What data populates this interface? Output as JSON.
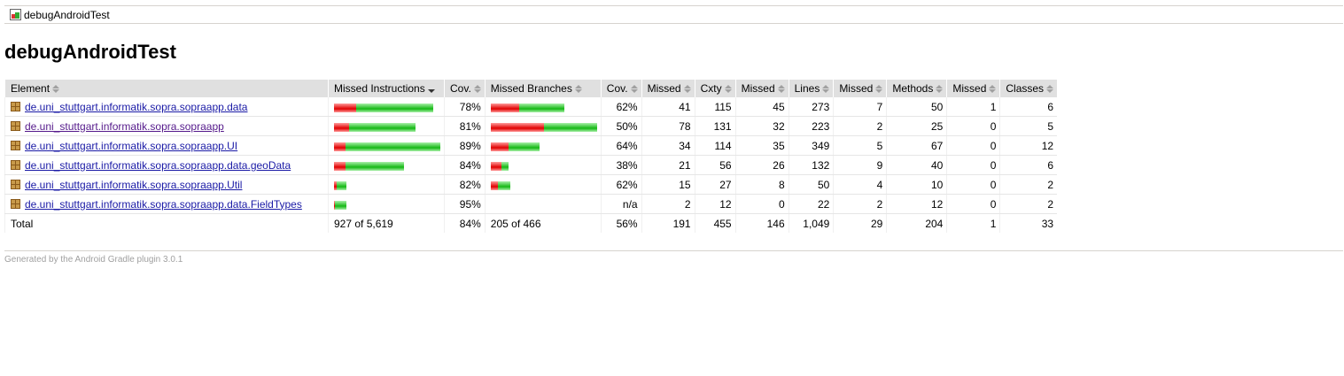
{
  "breadcrumb": {
    "label": "debugAndroidTest",
    "icon": "report-icon"
  },
  "page_title": "debugAndroidTest",
  "columns": [
    "Element",
    "Missed Instructions",
    "Cov.",
    "Missed Branches",
    "Cov.",
    "Missed",
    "Cxty",
    "Missed",
    "Lines",
    "Missed",
    "Methods",
    "Missed",
    "Classes"
  ],
  "rows": [
    {
      "name": "de.uni_stuttgart.informatik.sopra.sopraapp.data",
      "instr_cov": 78,
      "instr_cov_text": "78%",
      "branch_cov": 62,
      "branch_cov_text": "62%",
      "instr_bar_scale": 0.93,
      "branch_bar_scale": 0.69,
      "missed_cxty": "41",
      "cxty": "115",
      "missed_lines": "45",
      "lines": "273",
      "missed_methods": "7",
      "methods": "50",
      "missed_classes": "1",
      "classes": "6"
    },
    {
      "name": "de.uni_stuttgart.informatik.sopra.sopraapp",
      "instr_cov": 81,
      "instr_cov_text": "81%",
      "branch_cov": 50,
      "branch_cov_text": "50%",
      "instr_bar_scale": 0.77,
      "branch_bar_scale": 1.0,
      "missed_cxty": "78",
      "cxty": "131",
      "missed_lines": "32",
      "lines": "223",
      "missed_methods": "2",
      "methods": "25",
      "missed_classes": "0",
      "classes": "5"
    },
    {
      "name": "de.uni_stuttgart.informatik.sopra.sopraapp.UI",
      "instr_cov": 89,
      "instr_cov_text": "89%",
      "branch_cov": 64,
      "branch_cov_text": "64%",
      "instr_bar_scale": 1.0,
      "branch_bar_scale": 0.46,
      "missed_cxty": "34",
      "cxty": "114",
      "missed_lines": "35",
      "lines": "349",
      "missed_methods": "5",
      "methods": "67",
      "missed_classes": "0",
      "classes": "12"
    },
    {
      "name": "de.uni_stuttgart.informatik.sopra.sopraapp.data.geoData",
      "instr_cov": 84,
      "instr_cov_text": "84%",
      "branch_cov": 38,
      "branch_cov_text": "38%",
      "instr_bar_scale": 0.66,
      "branch_bar_scale": 0.17,
      "missed_cxty": "21",
      "cxty": "56",
      "missed_lines": "26",
      "lines": "132",
      "missed_methods": "9",
      "methods": "40",
      "missed_classes": "0",
      "classes": "6"
    },
    {
      "name": "de.uni_stuttgart.informatik.sopra.sopraapp.Util",
      "instr_cov": 82,
      "instr_cov_text": "82%",
      "branch_cov": 62,
      "branch_cov_text": "62%",
      "instr_bar_scale": 0.12,
      "branch_bar_scale": 0.18,
      "missed_cxty": "15",
      "cxty": "27",
      "missed_lines": "8",
      "lines": "50",
      "missed_methods": "4",
      "methods": "10",
      "missed_classes": "0",
      "classes": "2"
    },
    {
      "name": "de.uni_stuttgart.informatik.sopra.sopraapp.data.FieldTypes",
      "instr_cov": 95,
      "instr_cov_text": "95%",
      "branch_cov": null,
      "branch_cov_text": "n/a",
      "instr_bar_scale": 0.12,
      "branch_bar_scale": 0,
      "missed_cxty": "2",
      "cxty": "12",
      "missed_lines": "0",
      "lines": "22",
      "missed_methods": "2",
      "methods": "12",
      "missed_classes": "0",
      "classes": "2"
    }
  ],
  "total": {
    "label": "Total",
    "instr": "927 of 5,619",
    "instr_cov": "84%",
    "branch": "205 of 466",
    "branch_cov": "56%",
    "missed_cxty": "191",
    "cxty": "455",
    "missed_lines": "146",
    "lines": "1,049",
    "missed_methods": "29",
    "methods": "204",
    "missed_classes": "1",
    "classes": "33"
  },
  "footer": "Generated by the Android Gradle plugin 3.0.1",
  "colors": {
    "missed": "#e00000",
    "covered": "#14b814",
    "link": "#1a1aa6",
    "visited": "#551a8b"
  }
}
